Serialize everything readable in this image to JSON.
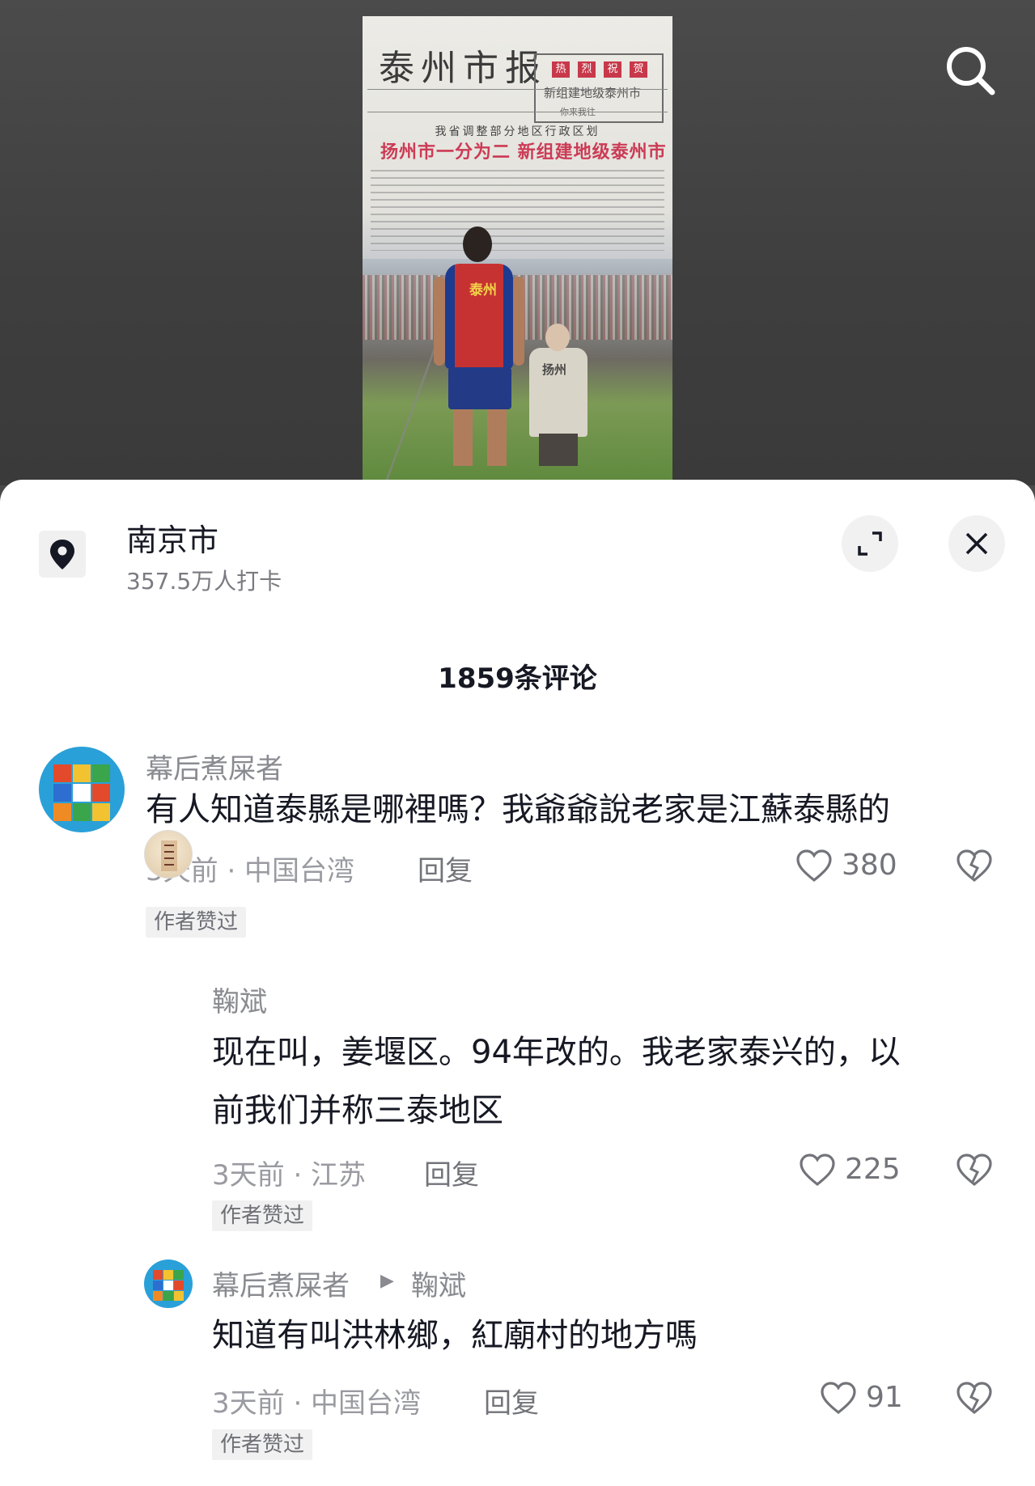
{
  "poster": {
    "newspaper_title": "泰州市报",
    "box_chips": [
      "热",
      "烈",
      "祝",
      "贺"
    ],
    "box_line1": "新组建地级泰州市",
    "box_line2": "你来我往",
    "subheading": "我省调整部分地区行政区划",
    "headline": "扬州市一分为二  新组建地级泰州市",
    "player_shirt": "泰州",
    "elder_shirt": "扬州"
  },
  "location": {
    "title": "南京市",
    "subtitle": "357.5万人打卡"
  },
  "comments_header": "1859条评论",
  "comments": [
    {
      "username": "幕后煮屎者",
      "text": "有人知道泰縣是哪裡嗎？我爺爺說老家是江蘇泰縣的",
      "meta": "3天前 · 中国台湾",
      "reply_label": "回复",
      "likes": "380",
      "badge": "作者赞过"
    },
    {
      "username": "鞠斌",
      "text_line1": "现在叫，姜堰区。94年改的。我老家泰兴的，以",
      "text_line2": "前我们并称三泰地区",
      "meta": "3天前 · 江苏",
      "reply_label": "回复",
      "likes": "225",
      "badge": "作者赞过"
    },
    {
      "username": "幕后煮屎者",
      "reply_to": "鞠斌",
      "text": "知道有叫洪林鄉，紅廟村的地方嗎",
      "meta": "3天前 · 中国台湾",
      "reply_label": "回复",
      "likes": "91",
      "badge": "作者赞过"
    }
  ],
  "colors": {
    "primary_text": "#161823",
    "secondary_text": "#8a8b91",
    "badge_bg": "#f1f1f2"
  }
}
